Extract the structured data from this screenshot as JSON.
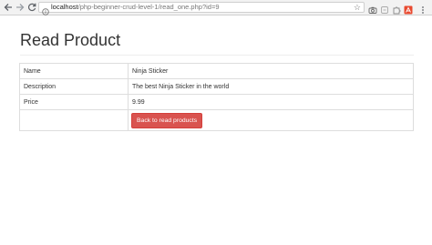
{
  "browser": {
    "url_host": "localhost",
    "url_path": "/php-beginner-crud-level-1/read_one.php?id=9"
  },
  "page": {
    "title": "Read Product"
  },
  "product": {
    "rows": [
      {
        "label": "Name",
        "value": "Ninja Sticker"
      },
      {
        "label": "Description",
        "value": "The best Ninja Sticker in the world"
      },
      {
        "label": "Price",
        "value": "9.99"
      }
    ],
    "back_button_label": "Back to read products"
  },
  "colors": {
    "danger": "#d9534f",
    "text": "#333333",
    "border": "#dddddd"
  }
}
